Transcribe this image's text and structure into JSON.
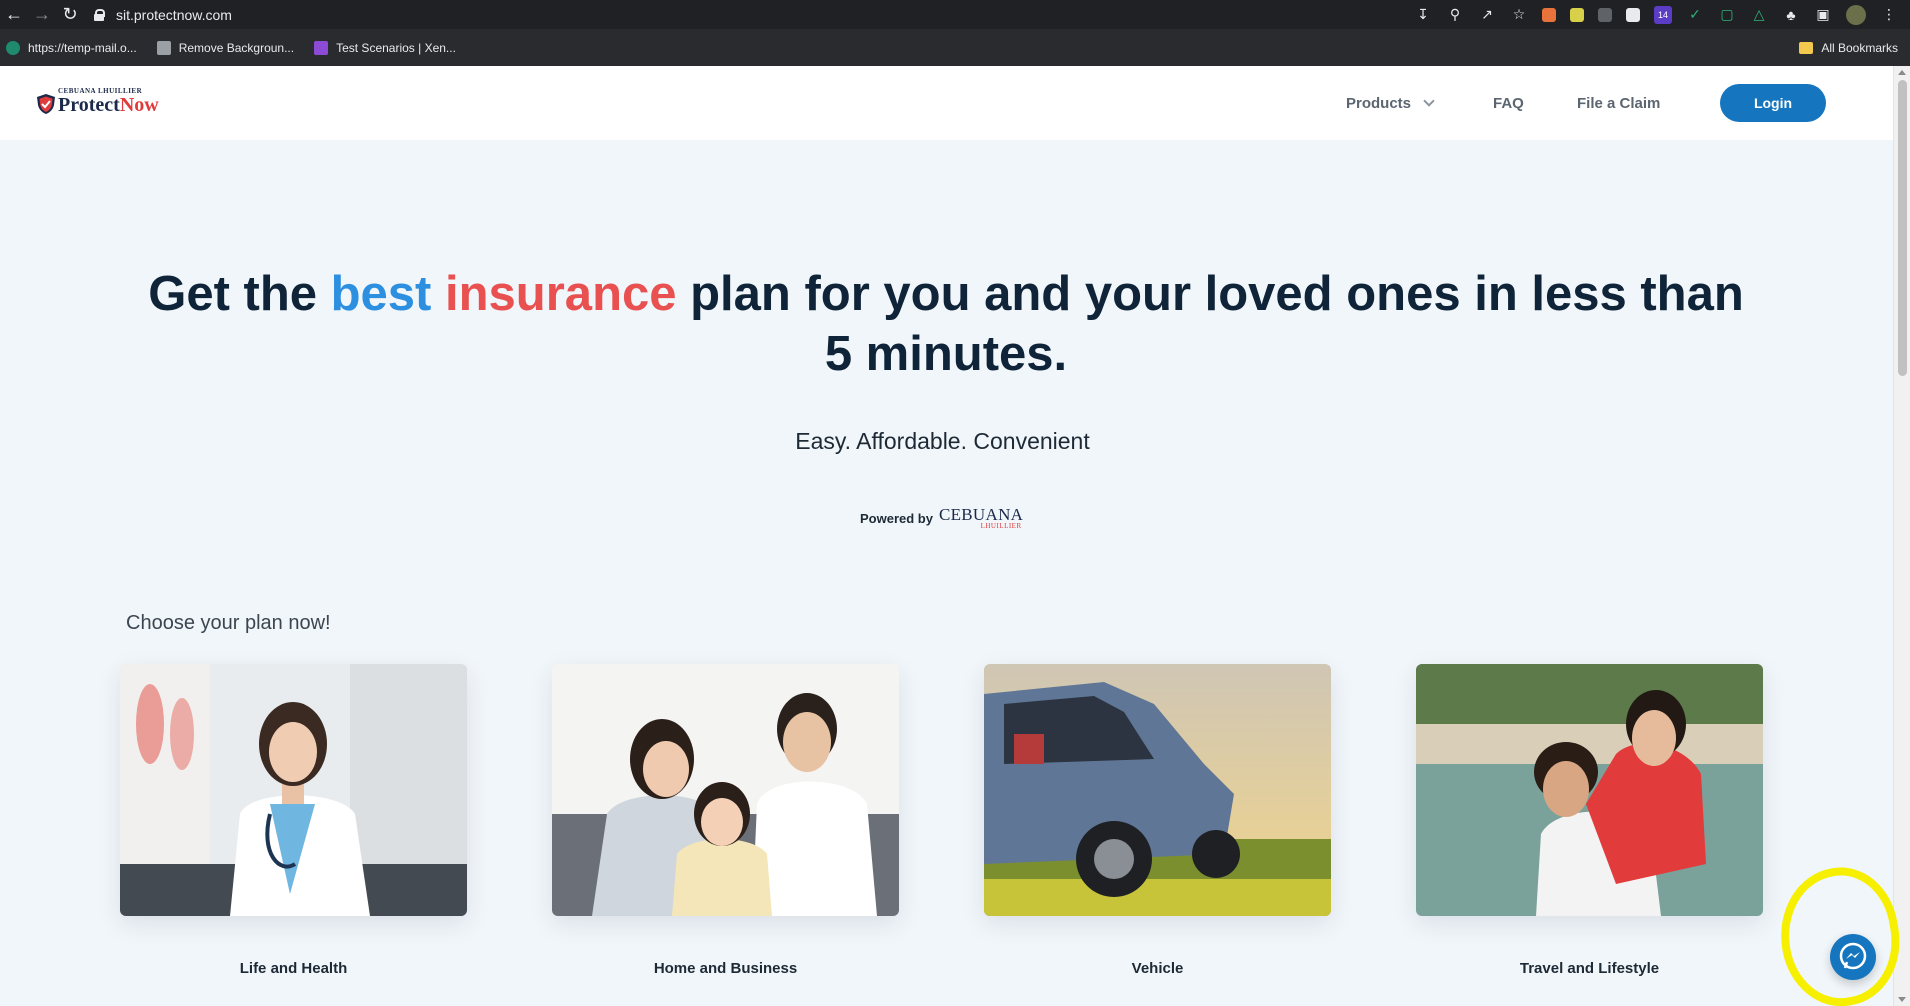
{
  "browser": {
    "url": "sit.protectnow.com",
    "bookmarks": [
      {
        "label": "https://temp-mail.o..."
      },
      {
        "label": "Remove Backgroun..."
      },
      {
        "label": "Test Scenarios | Xen..."
      }
    ],
    "all_bookmarks_label": "All Bookmarks",
    "extension_badge": "14"
  },
  "header": {
    "logo_small": "CEBUANA LHUILLIER",
    "logo_part1": "Protect",
    "logo_part2": "Now",
    "nav": {
      "products": "Products",
      "faq": "FAQ",
      "file_claim": "File a Claim",
      "login": "Login"
    }
  },
  "hero": {
    "title_pre": "Get the ",
    "title_blue": "best",
    "title_space": " ",
    "title_red": "insurance",
    "title_post": " plan for you and your loved ones in less than 5 minutes.",
    "tagline": "Easy. Affordable. Convenient",
    "powered_by": "Powered by",
    "powered_brand": "CEBUANA",
    "powered_sub": "LHUILLIER"
  },
  "plans": {
    "heading": "Choose your plan now!",
    "items": [
      {
        "label": "Life and Health"
      },
      {
        "label": "Home and Business"
      },
      {
        "label": "Vehicle"
      },
      {
        "label": "Travel and Lifestyle"
      }
    ]
  },
  "colors": {
    "accent_blue": "#1576bf",
    "title_blue": "#2d8fe0",
    "title_red": "#e95050",
    "highlight": "#f6f000"
  }
}
